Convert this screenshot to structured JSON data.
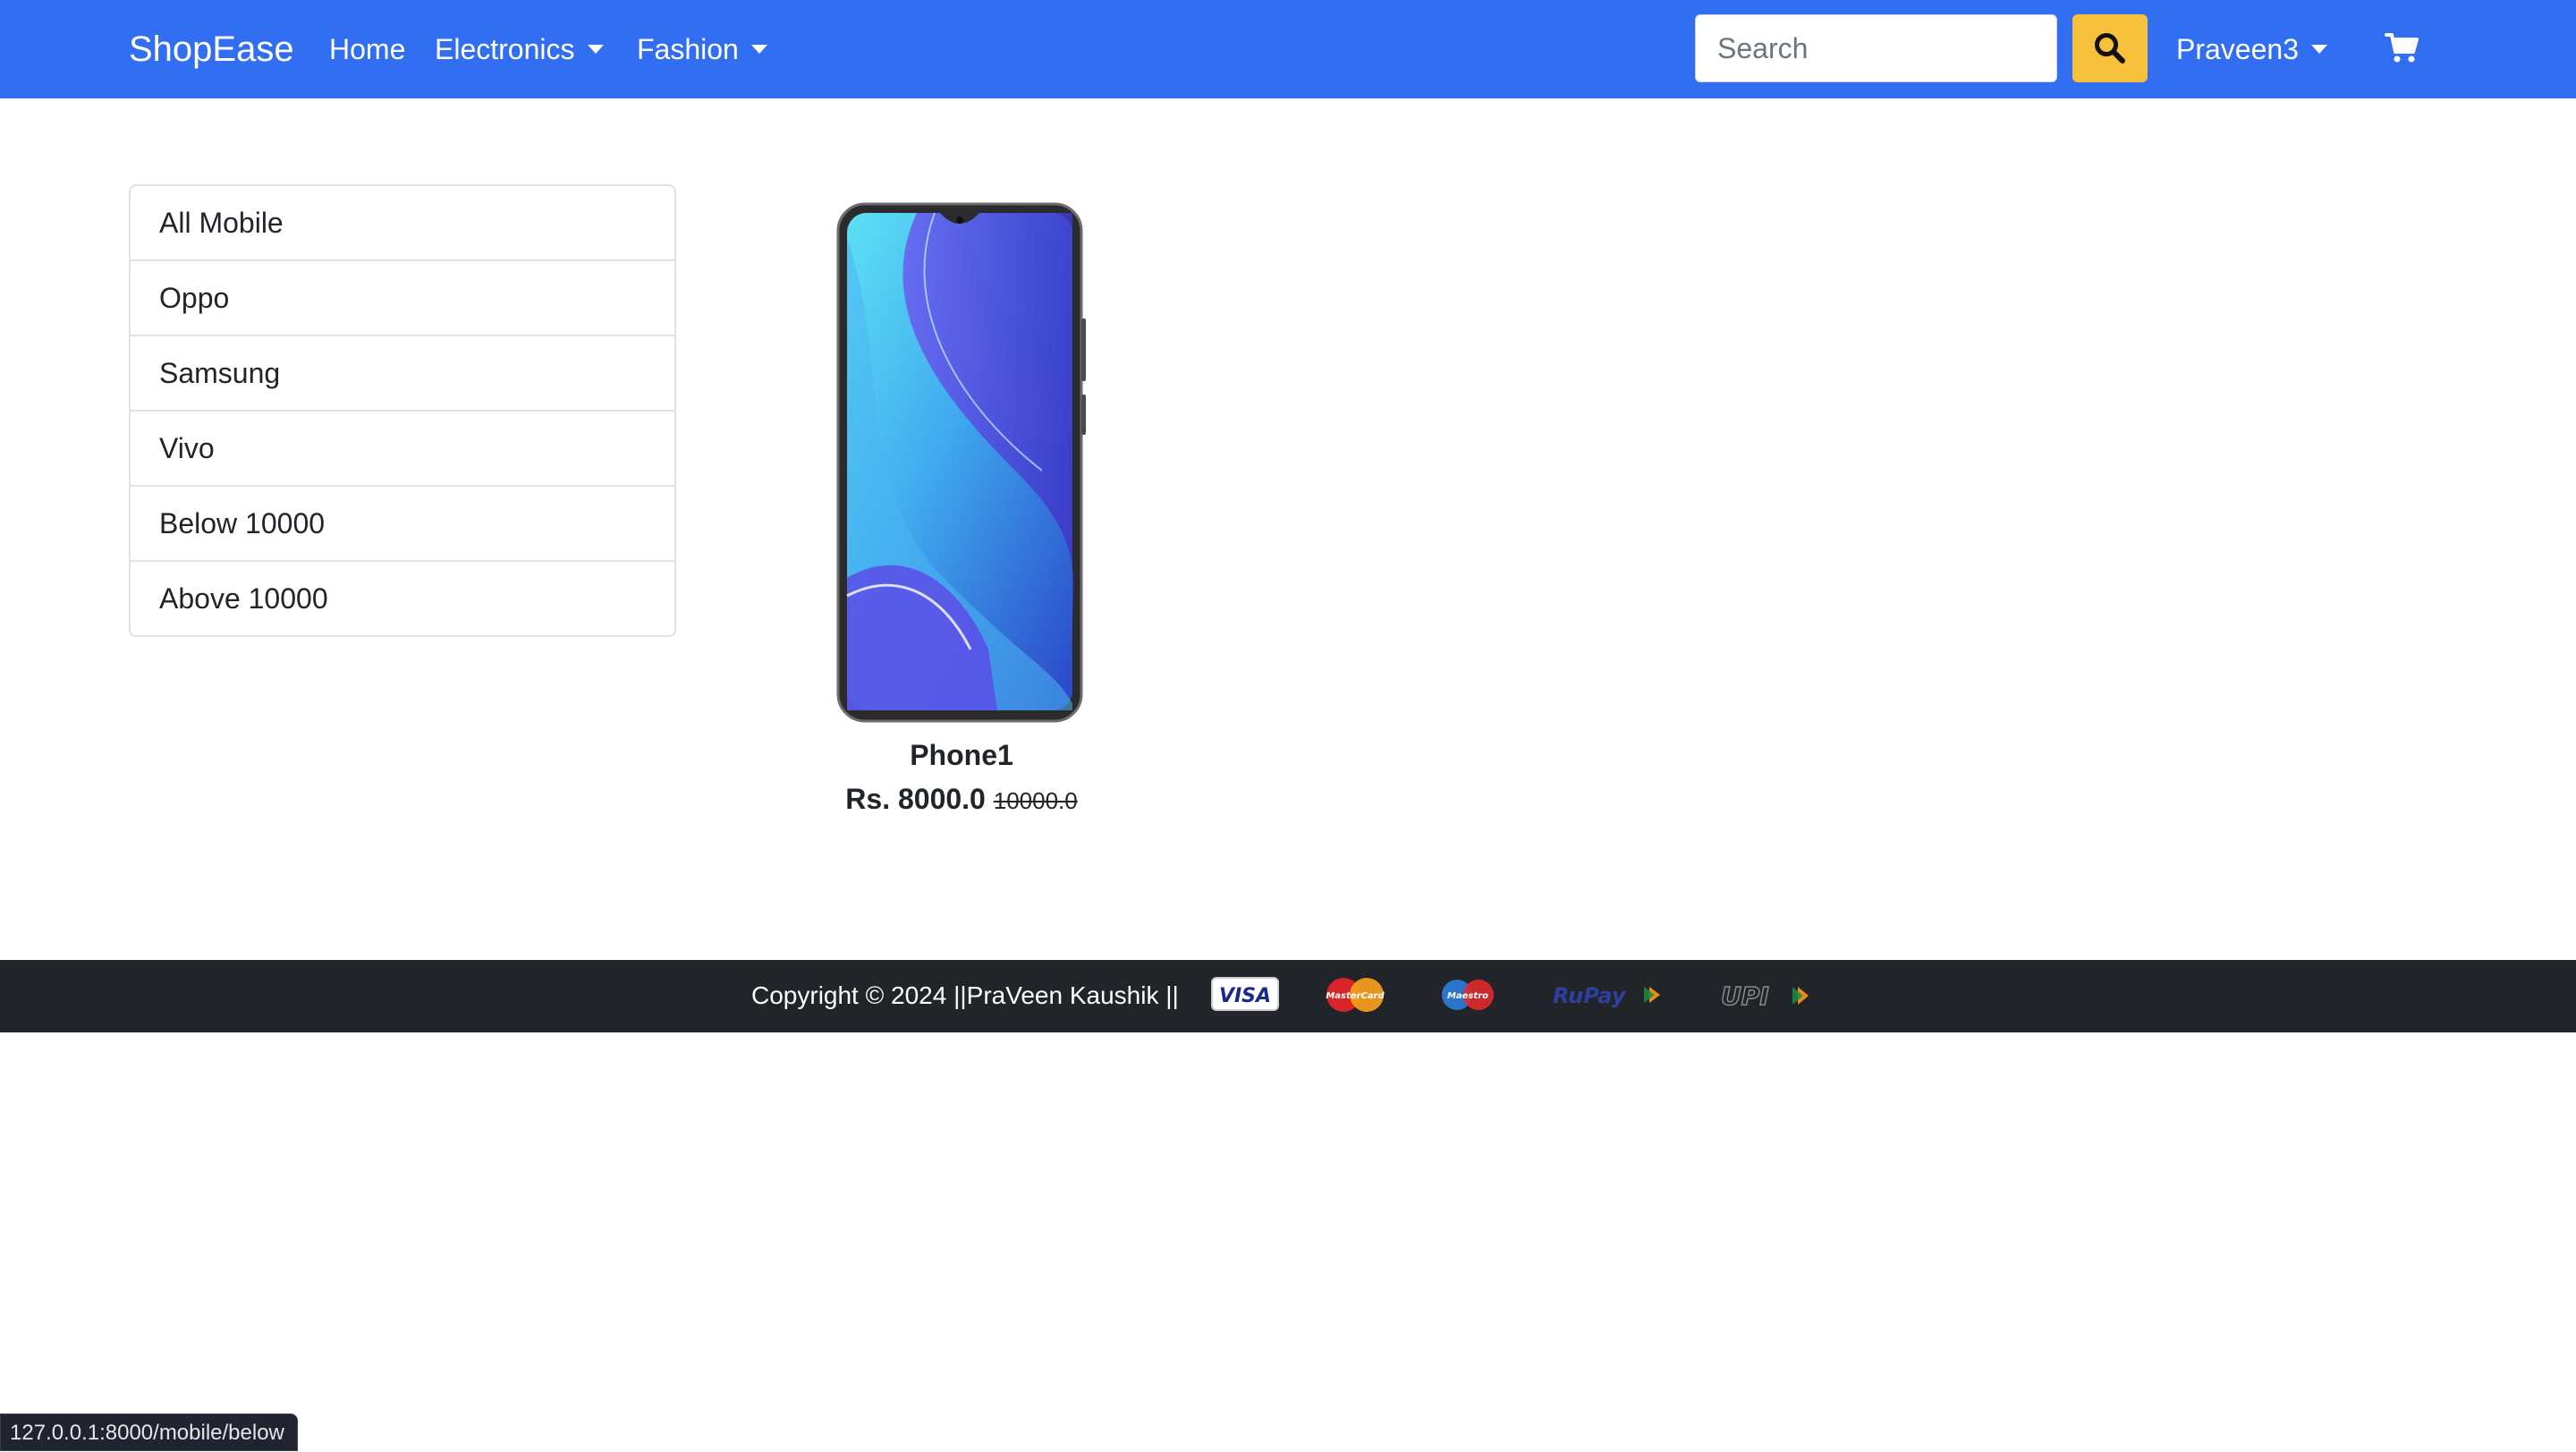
{
  "navbar": {
    "brand": "ShopEase",
    "links": {
      "home": "Home",
      "electronics": "Electronics",
      "fashion": "Fashion"
    },
    "search_placeholder": "Search",
    "search_icon": "search-icon",
    "user": "Praveen3",
    "cart_icon": "shopping-cart-icon",
    "background_color": "#316ef2",
    "search_button_color": "#f7c03b"
  },
  "sidebar": {
    "items": [
      {
        "label": "All Mobile"
      },
      {
        "label": "Oppo"
      },
      {
        "label": "Samsung"
      },
      {
        "label": "Vivo"
      },
      {
        "label": "Below 10000"
      },
      {
        "label": "Above 10000"
      }
    ]
  },
  "products": [
    {
      "name": "Phone1",
      "price": "Rs. 8000.0",
      "original_price": "10000.0"
    }
  ],
  "footer": {
    "copyright": "Copyright © 2024 ||PraVeen Kaushik ||",
    "payment_logos": {
      "visa": "VISA",
      "mastercard": "MasterCard",
      "maestro": "Maestro",
      "rupay": "RuPay",
      "upi": "UPI"
    },
    "background_color": "#212529"
  },
  "status_bar": {
    "url": "127.0.0.1:8000/mobile/below"
  }
}
